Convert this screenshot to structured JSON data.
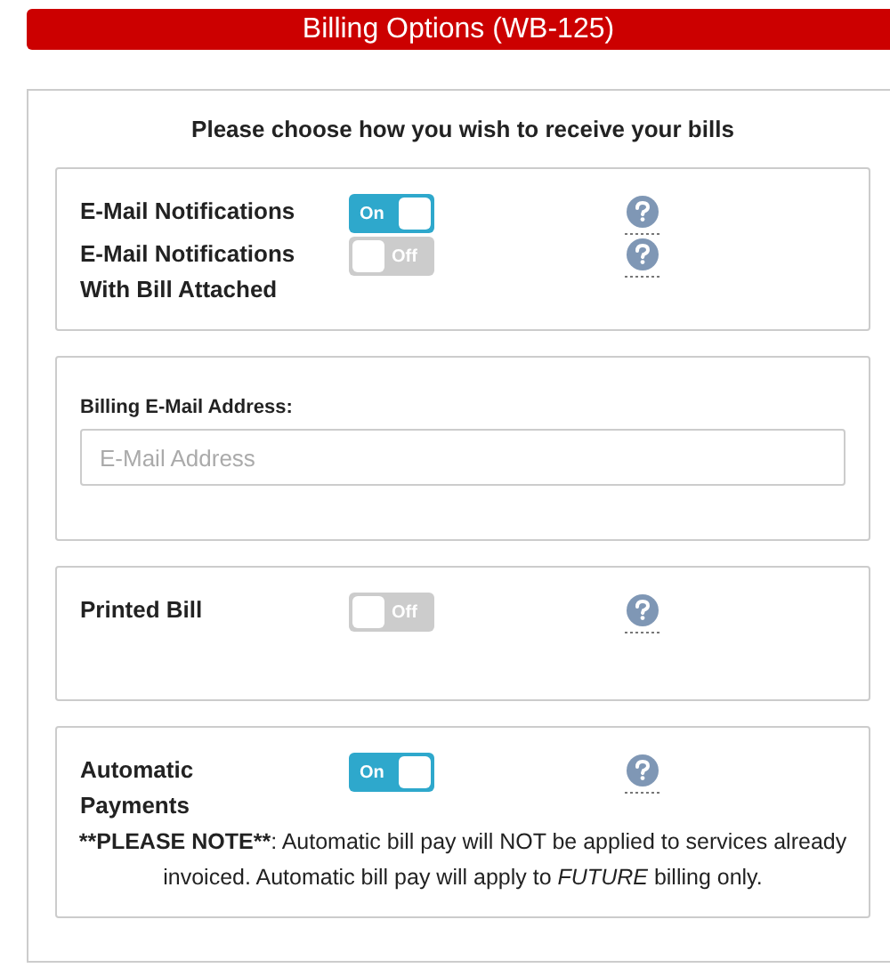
{
  "header": {
    "title": "Billing Options (WB-125)"
  },
  "panel": {
    "intro": "Please choose how you wish to receive your bills",
    "sections": [
      {
        "kind": "toggles",
        "rows": [
          {
            "label": "E-Mail Notifications",
            "on": true,
            "toggle_text": "On"
          },
          {
            "label": "E-Mail Notifications With Bill Attached",
            "on": false,
            "toggle_text": "Off"
          }
        ]
      },
      {
        "kind": "email",
        "label": "Billing E-Mail Address:",
        "placeholder": "E-Mail Address"
      },
      {
        "kind": "toggles",
        "rows": [
          {
            "label": "Printed Bill",
            "on": false,
            "toggle_text": "Off"
          }
        ]
      },
      {
        "kind": "toggles",
        "rows": [
          {
            "label": "Automatic Payments",
            "on": true,
            "toggle_text": "On"
          }
        ],
        "note": {
          "lead": "**PLEASE NOTE**",
          "text": ": Automatic bill pay will NOT be applied to services already invoiced. Automatic bill pay will apply to *FUTURE* billing only."
        }
      }
    ]
  }
}
